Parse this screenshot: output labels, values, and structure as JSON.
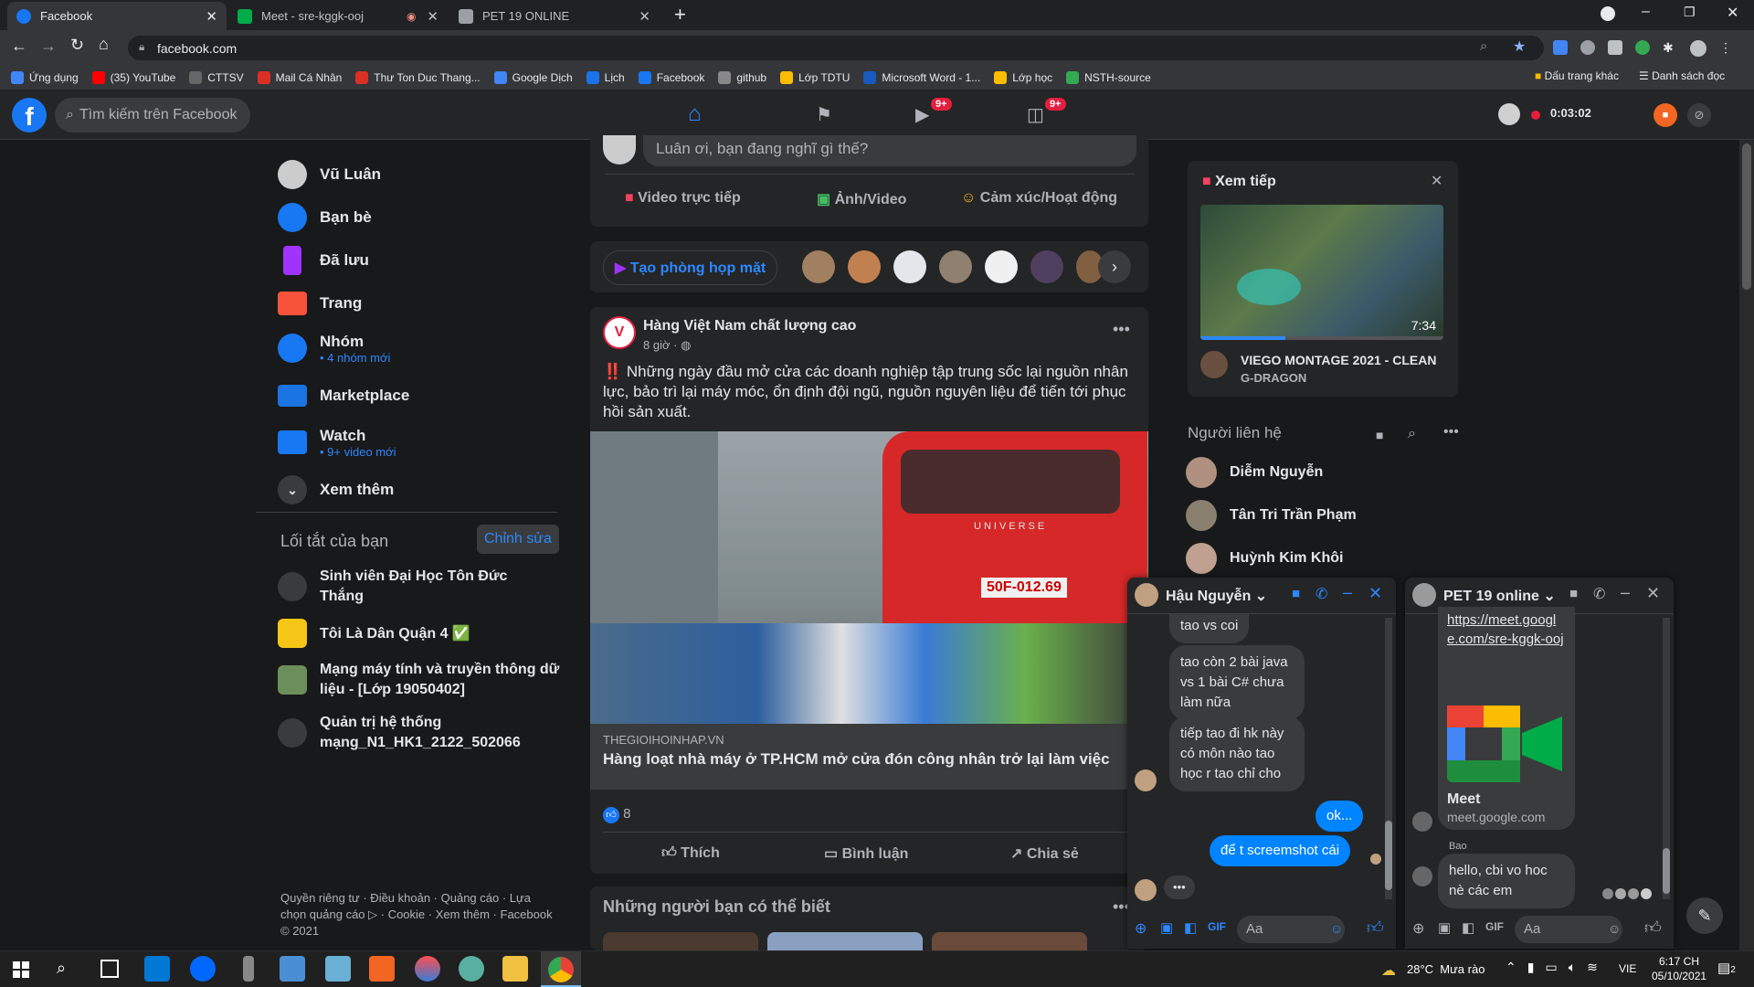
{
  "tabs": [
    {
      "label": "Facebook",
      "color": "#1877f2"
    },
    {
      "label": "Meet - sre-kggk-ooj",
      "color": "#00ac47"
    },
    {
      "label": "PET 19 ONLINE",
      "color": "#9aa0a6"
    }
  ],
  "url": "facebook.com",
  "bookmarks": [
    {
      "label": "Ứng dụng",
      "color": "#4285f4"
    },
    {
      "label": "(35) YouTube",
      "color": "#ff0000"
    },
    {
      "label": "CTTSV",
      "color": "#666"
    },
    {
      "label": "Mail Cá Nhân",
      "color": "#d93025"
    },
    {
      "label": "Thư Ton Duc Thang...",
      "color": "#d93025"
    },
    {
      "label": "Google Dịch",
      "color": "#4285f4"
    },
    {
      "label": "Lịch",
      "color": "#1a73e8"
    },
    {
      "label": "Facebook",
      "color": "#1877f2"
    },
    {
      "label": "github",
      "color": "#888"
    },
    {
      "label": "Lớp TDTU",
      "color": "#fbbc04"
    },
    {
      "label": "Microsoft Word - 1...",
      "color": "#185abd"
    },
    {
      "label": "Lớp học",
      "color": "#fbbc04"
    },
    {
      "label": "NSTH-source",
      "color": "#34a853"
    }
  ],
  "bookmarks_right": [
    "Dấu trang khác",
    "Danh sách đọc"
  ],
  "header": {
    "search_placeholder": "Tìm kiếm trên Facebook",
    "badge_watch": "9+",
    "badge_groups": "9+",
    "timer": "0:03:02"
  },
  "left": {
    "items": [
      {
        "label": "Vũ Luân",
        "sub": "",
        "color": "#888"
      },
      {
        "label": "Bạn bè",
        "sub": "",
        "color": "#1877f2"
      },
      {
        "label": "Đã lưu",
        "sub": "",
        "color": "#a033ff"
      },
      {
        "label": "Trang",
        "sub": "",
        "color": "#f7533b"
      },
      {
        "label": "Nhóm",
        "sub": "• 4 nhóm mới",
        "color": "#1877f2"
      },
      {
        "label": "Marketplace",
        "sub": "",
        "color": "#1b74e4"
      },
      {
        "label": "Watch",
        "sub": "• 9+ video mới",
        "color": "#1877f2"
      },
      {
        "label": "Xem thêm",
        "sub": "",
        "color": "#3a3b3c"
      }
    ],
    "shortcuts_title": "Lối tắt của bạn",
    "edit": "Chỉnh sửa",
    "shortcuts": [
      {
        "label": "Sinh viên Đại Học Tôn Đức Thắng",
        "color": "#3a3b3c"
      },
      {
        "label": "Tôi Là Dân Quận 4 ✅",
        "color": "#f5c518"
      },
      {
        "label": "Mạng máy tính và truyền thông dữ liệu - [Lớp 19050402]",
        "color": "#6b8e5a"
      },
      {
        "label": "Quản trị hệ thống mạng_N1_HK1_2122_502066",
        "color": "#3a3b3c"
      }
    ],
    "footer": "Quyền riêng tư · Điều khoản · Quảng cáo · Lựa chọn quảng cáo ▷ · Cookie · Xem thêm · Facebook © 2021"
  },
  "composer": {
    "placeholder": "Luân ơi, bạn đang nghĩ gì thế?",
    "live": "Video trực tiếp",
    "photo": "Ảnh/Video",
    "feeling": "Cảm xúc/Hoạt động"
  },
  "rooms": {
    "label": "Tạo phòng họp mặt"
  },
  "post": {
    "author": "Hàng Việt Nam chất lượng cao",
    "time": "8 giờ ·",
    "text": "‼️ Những ngày đầu mở cửa các doanh nghiệp tập trung sốc lại nguồn nhân lực, bảo trì lại máy móc, ổn định đội ngũ, nguồn nguyên liệu để tiến tới phục hồi sản xuất.",
    "domain": "THEGIOIHOINHAP.VN",
    "link_title": "Hàng loạt nhà máy ở TP.HCM mở cửa đón công nhân trở lại làm việc",
    "likes": "8",
    "like": "Thích",
    "comment": "Bình luận",
    "share": "Chia sẻ",
    "bus_plate": "50F-012.69",
    "bus_brand": "UNIVERSE"
  },
  "pymk": {
    "title": "Những người bạn có thể biết"
  },
  "watch_card": {
    "title": "Xem tiếp",
    "duration": "7:34",
    "video_title": "VIEGO MONTAGE 2021 - CLEAN",
    "channel": "G-DRAGON",
    "progress": 0.35
  },
  "contacts": {
    "title": "Người liên hệ",
    "list": [
      "Diễm Nguyễn",
      "Tân Tri Trần Phạm",
      "Huỳnh Kim Khôi"
    ]
  },
  "chat1": {
    "name": "Hậu Nguyễn",
    "messages": [
      "tao vs coi",
      "tao còn 2 bài java vs 1 bài C# chưa làm nữa",
      "tiếp tao đi hk này có môn nào tao học r tao chỉ cho"
    ],
    "mine": [
      "ok...",
      "để t screemshot cái"
    ],
    "typing": "•••",
    "input": "Aa"
  },
  "chat2": {
    "name": "PET 19 online",
    "link": "https://meet.google.com/sre-kggk-ooj",
    "meet_title": "Meet",
    "meet_domain": "meet.google.com",
    "sender": "Bao",
    "message": "hello, cbi vo hoc nè các em",
    "input": "Aa"
  },
  "taskbar": {
    "weather": "28°C  Mưa rào",
    "lang": "VIE",
    "time": "6:17 CH",
    "date": "05/10/2021",
    "notif": "2"
  }
}
